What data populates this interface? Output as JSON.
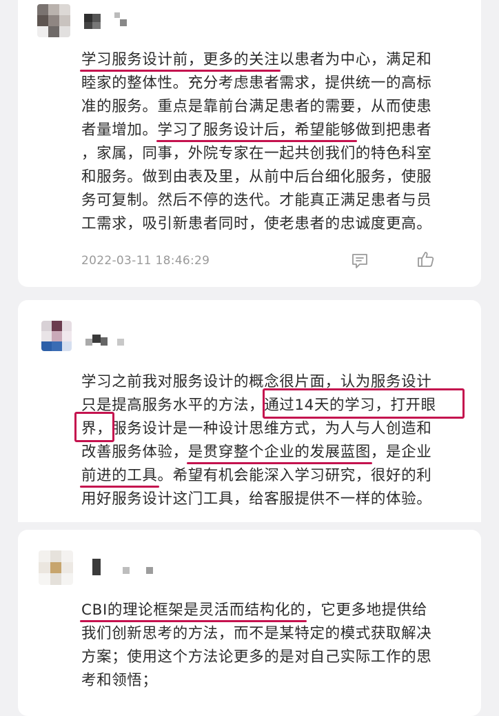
{
  "comments": [
    {
      "timestamp": "2022-03-11 18:46:29",
      "lines": [
        [
          {
            "t": "学习服务设计前，更多的关注",
            "u": true
          },
          {
            "t": "以患者为中心，满足和",
            "u": false
          }
        ],
        [
          {
            "t": "睦家的整体性。充分考虑患者需求，提供统一的高标",
            "u": false
          }
        ],
        [
          {
            "t": "准的服务。重点是靠前台满足患者的需要，从而使患",
            "u": false
          }
        ],
        [
          {
            "t": "者量增加。",
            "u": false
          },
          {
            "t": "学习了服务设计后，希望能够",
            "u": true
          },
          {
            "t": "做到把患者",
            "u": false
          }
        ],
        [
          {
            "t": "，家属，同事，外院专家在一起共创我们的特色科室",
            "u": false
          }
        ],
        [
          {
            "t": "和服务。做到由表及里，从前中后台细化服务，使服",
            "u": false
          }
        ],
        [
          {
            "t": "务可复制。然后不停的迭代。才能真正满足患者与员",
            "u": false
          }
        ],
        [
          {
            "t": "工需求，吸引新患者同时，使老患者的忠诚度更高。",
            "u": false
          }
        ]
      ]
    },
    {
      "lines": [
        [
          {
            "t": "学习之前我对服务设计的概念很片面，认为服务设计",
            "u": false
          }
        ],
        [
          {
            "t": "只是提高服务水平的方法，",
            "u": false
          },
          {
            "t": "通过14天的学习，打开眼",
            "u": false
          }
        ],
        [
          {
            "t": "界，",
            "u": false
          },
          {
            "t": "服务设计是一种设计思维方式，为人与人创造和",
            "u": false
          }
        ],
        [
          {
            "t": "改善服务体验，",
            "u": false
          },
          {
            "t": "是贯穿整个企业的发展蓝图",
            "u": true
          },
          {
            "t": "，是企业",
            "u": false
          }
        ],
        [
          {
            "t": "前进的工具",
            "u": true
          },
          {
            "t": "。希望有机会能深入学习研究，很好的利",
            "u": false
          }
        ],
        [
          {
            "t": "用好服务设计这门工具，给客服提供不一样的体验。",
            "u": false
          }
        ]
      ]
    },
    {
      "lines": [
        [
          {
            "t": "CBI的理论框架是灵活而结构化的",
            "u": true
          },
          {
            "t": "，它更多地提供给",
            "u": false
          }
        ],
        [
          {
            "t": "我们创新思考的方法，而不是某特定的模式获取解决",
            "u": false
          }
        ],
        [
          {
            "t": "方案；使用这个方法论更多的是对自己实际工作的思",
            "u": false
          }
        ],
        [
          {
            "t": "考和领悟；",
            "u": false
          }
        ]
      ]
    }
  ],
  "icons": {
    "comment": "comment-icon",
    "like": "thumbs-up-icon"
  },
  "colors": {
    "highlight": "#c4124e",
    "meta_text": "#9a9a9a",
    "card_bg": "#ffffff",
    "page_bg": "#f1f1f3"
  }
}
